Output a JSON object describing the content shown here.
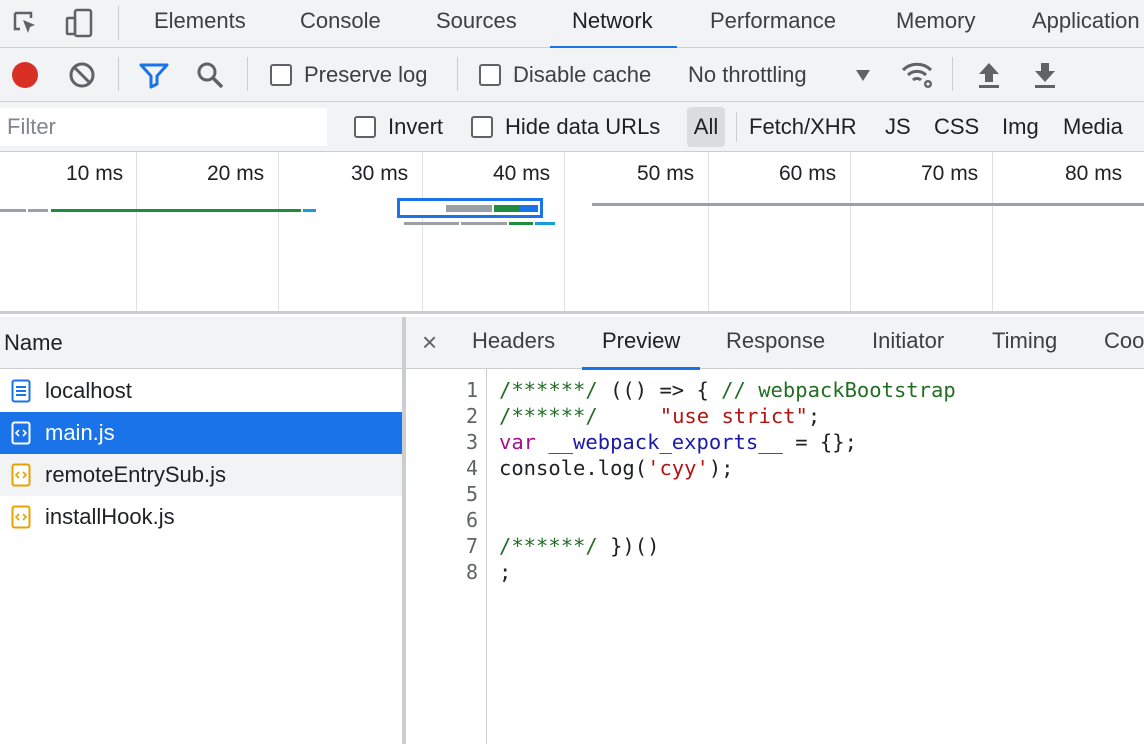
{
  "devtools_tabs": [
    "Elements",
    "Console",
    "Sources",
    "Network",
    "Performance",
    "Memory",
    "Application"
  ],
  "active_tab": "Network",
  "toolbar": {
    "preserve_log": "Preserve log",
    "disable_cache": "Disable cache",
    "throttling": "No throttling"
  },
  "filter": {
    "placeholder": "Filter",
    "invert": "Invert",
    "hide_data_urls": "Hide data URLs",
    "types": [
      "All",
      "Fetch/XHR",
      "JS",
      "CSS",
      "Img",
      "Media"
    ]
  },
  "timeline": {
    "ticks": [
      "10 ms",
      "20 ms",
      "30 ms",
      "40 ms",
      "50 ms",
      "60 ms",
      "70 ms",
      "80 ms"
    ]
  },
  "requests": {
    "header": "Name",
    "items": [
      {
        "name": "localhost",
        "type": "document"
      },
      {
        "name": "main.js",
        "type": "script"
      },
      {
        "name": "remoteEntrySub.js",
        "type": "script"
      },
      {
        "name": "installHook.js",
        "type": "script"
      }
    ],
    "selected": "main.js"
  },
  "detail": {
    "close": "×",
    "tabs": [
      "Headers",
      "Preview",
      "Response",
      "Initiator",
      "Timing",
      "Coo"
    ],
    "active_tab": "Preview",
    "line_numbers": [
      "1",
      "2",
      "3",
      "4",
      "5",
      "6",
      "7",
      "8"
    ],
    "code": {
      "l1_comment": "/******/",
      "l1_code": " (() => { ",
      "l1_comment2": "// webpackBootstrap",
      "l2_comment": "/******/",
      "l2_pad": " \t",
      "l2_string": "\"use strict\"",
      "l2_end": ";",
      "l3_keyword": "var",
      "l3_space": " ",
      "l3_var": "__webpack_exports__",
      "l3_end": " = {};",
      "l4_code": "console.log(",
      "l4_string": "'cyy'",
      "l4_end": ");",
      "l7_comment": "/******/",
      "l7_code": " })()",
      "l8_code": ";"
    }
  },
  "colors": {
    "accent": "#1a73e8",
    "record": "#d93025",
    "waterfall_green": "#1e8e3e"
  }
}
